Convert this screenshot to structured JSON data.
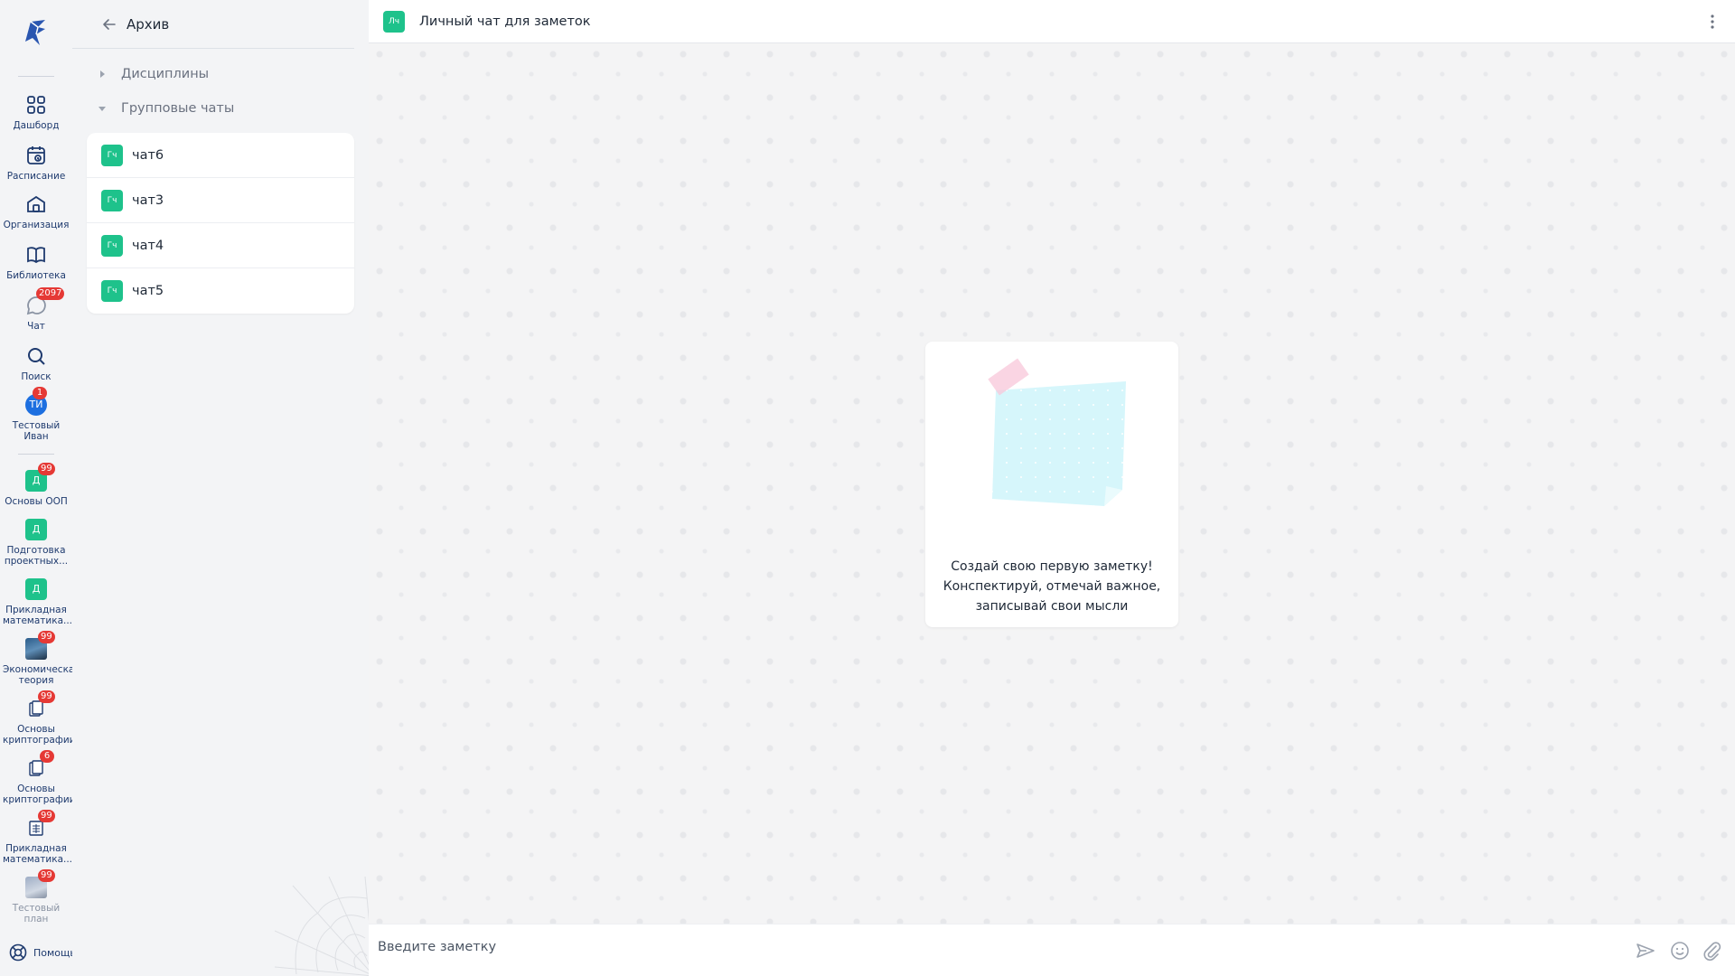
{
  "rail": {
    "items": [
      {
        "label": "Дашборд",
        "icon": "dashboard-icon"
      },
      {
        "label": "Расписание",
        "icon": "schedule-icon"
      },
      {
        "label": "Организация",
        "icon": "organization-icon"
      },
      {
        "label": "Библиотека",
        "icon": "library-icon"
      },
      {
        "label": "Чат",
        "icon": "chat-icon",
        "badge": "2097"
      },
      {
        "label": "Поиск",
        "icon": "search-icon"
      }
    ],
    "profile": {
      "initials": "ТИ",
      "name": "Тестовый Иван",
      "badge": "1"
    },
    "courses": [
      {
        "label": "Основы ООП",
        "badge": "99",
        "avatar": "Д"
      },
      {
        "label": "Подготовка проектных...",
        "avatar": "Д"
      },
      {
        "label": "Прикладная математика...",
        "avatar": "Д"
      },
      {
        "label": "Экономическая теория",
        "badge": "99"
      },
      {
        "label": "Основы криптографии",
        "badge": "99"
      },
      {
        "label": "Основы криптографии",
        "badge": "6"
      },
      {
        "label": "Прикладная математика...",
        "badge": "99"
      },
      {
        "label": "Тестовый план",
        "badge": "99"
      }
    ],
    "help_label": "Помощь"
  },
  "panel": {
    "title": "Архив",
    "sections": [
      {
        "label": "Дисциплины",
        "expanded": false
      },
      {
        "label": "Групповые чаты",
        "expanded": true
      }
    ],
    "chats": [
      {
        "avatar": "Гч",
        "name": "чат6"
      },
      {
        "avatar": "Гч",
        "name": "чат3"
      },
      {
        "avatar": "Гч",
        "name": "чат4"
      },
      {
        "avatar": "Гч",
        "name": "чат5"
      }
    ]
  },
  "main": {
    "chat_avatar": "Лч",
    "chat_title": "Личный чат для заметок",
    "empty_text": [
      "Создай свою первую заметку!",
      "Конспектируй, отмечай важное,",
      "записывай свои мысли"
    ],
    "input_placeholder": "Введите заметку"
  },
  "colors": {
    "accent_green": "#1ec28b",
    "badge_red": "#e53935",
    "rail_text": "#1e3a6e",
    "avatar_blue": "#1d6fe0"
  }
}
